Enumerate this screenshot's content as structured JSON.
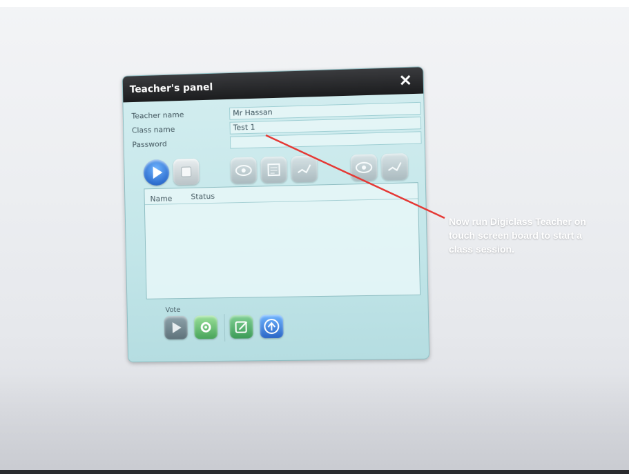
{
  "panel": {
    "title": "Teacher's panel",
    "close_icon": "close-icon"
  },
  "form": {
    "teacher_name_label": "Teacher name",
    "teacher_name_value": "Mr Hassan",
    "class_name_label": "Class name",
    "class_name_value": "Test 1",
    "password_label": "Password",
    "password_value": ""
  },
  "toolbar": {
    "icons": [
      "play-icon",
      "stop-icon",
      "eye-icon",
      "list-icon",
      "chart-icon",
      "eye-icon",
      "chart-icon"
    ]
  },
  "list": {
    "columns": [
      "Name",
      "Status"
    ]
  },
  "vote": {
    "label": "Vote",
    "icons": [
      "play-icon",
      "gear-icon",
      "edit-icon",
      "upload-icon"
    ]
  },
  "annotation": {
    "text": "Now run Digiclass Teacher on touch screen board to start a class session."
  },
  "colors": {
    "annotation_arrow": "#e53935",
    "annotation_text": "#ffffff"
  }
}
